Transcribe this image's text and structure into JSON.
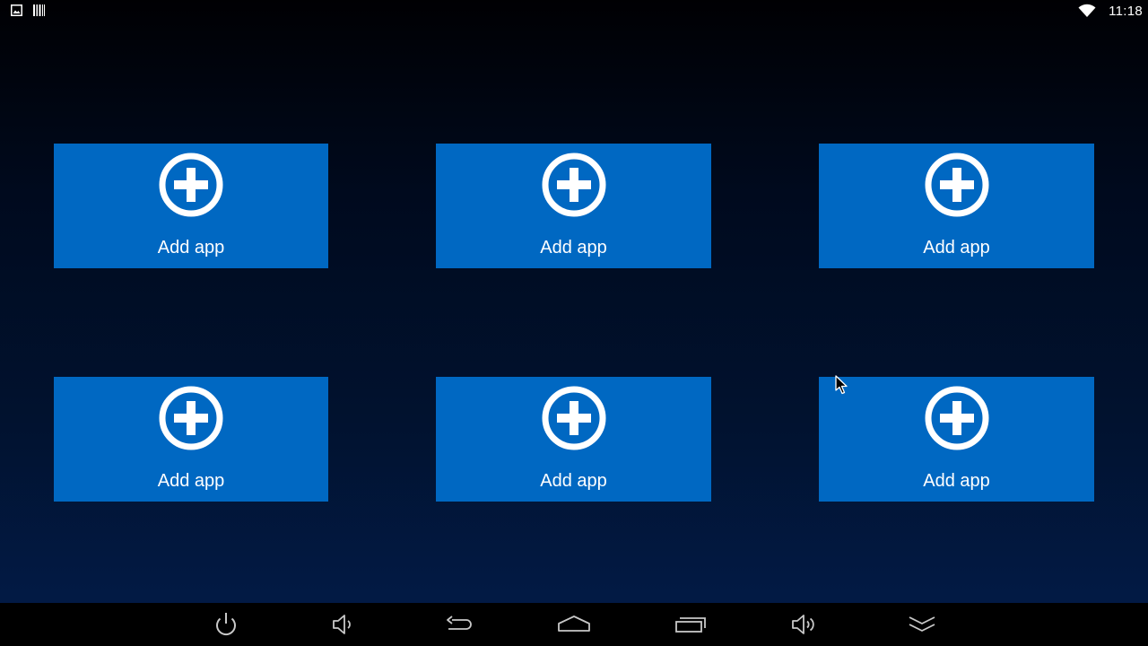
{
  "status_bar": {
    "left_icons": [
      "image-notification-icon",
      "barcode-notification-icon"
    ],
    "wifi_icon": "wifi-icon",
    "time": "11:18"
  },
  "tiles": [
    {
      "label": "Add app",
      "icon": "add-circle-icon"
    },
    {
      "label": "Add app",
      "icon": "add-circle-icon"
    },
    {
      "label": "Add app",
      "icon": "add-circle-icon"
    },
    {
      "label": "Add app",
      "icon": "add-circle-icon"
    },
    {
      "label": "Add app",
      "icon": "add-circle-icon"
    },
    {
      "label": "Add app",
      "icon": "add-circle-icon"
    }
  ],
  "nav_bar": {
    "buttons": [
      "power-icon",
      "volume-down-icon",
      "back-icon",
      "home-icon",
      "recent-apps-icon",
      "volume-up-icon",
      "hide-bar-icon"
    ]
  },
  "colors": {
    "tile": "#0068c2",
    "background_top": "#000003",
    "background_bottom": "#021c4a",
    "nav_bar": "#000000",
    "icon": "#ffffff"
  }
}
